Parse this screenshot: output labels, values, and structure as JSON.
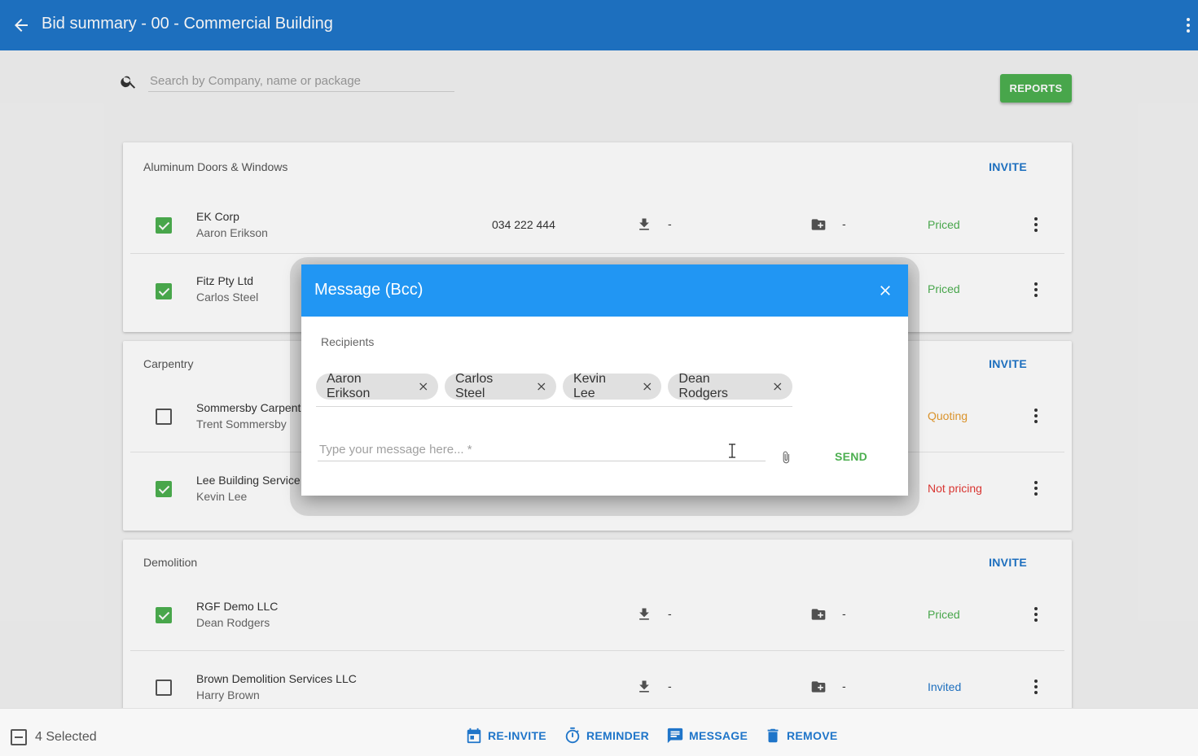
{
  "appbar": {
    "title": "Bid summary - 00 - Commercial Building"
  },
  "search": {
    "placeholder": "Search by Company, name or package"
  },
  "reports_label": "REPORTS",
  "groups": [
    {
      "title": "Aluminum Doors & Windows",
      "invite": "INVITE",
      "rows": [
        {
          "company": "EK Corp",
          "contact": "Aaron Erikson",
          "phone": "034 222 444",
          "download": "-",
          "folder": "-",
          "status": "Priced",
          "checked": true
        },
        {
          "company": "Fitz Pty Ltd",
          "contact": "Carlos Steel",
          "status": "Priced",
          "checked": true
        }
      ]
    },
    {
      "title": "Carpentry",
      "invite": "INVITE",
      "rows": [
        {
          "company": "Sommersby Carpent",
          "contact": "Trent Sommersby",
          "status": "Quoting",
          "checked": false
        },
        {
          "company": "Lee Building Service",
          "contact": "Kevin Lee",
          "status": "Not pricing",
          "checked": true
        }
      ]
    },
    {
      "title": "Demolition",
      "invite": "INVITE",
      "rows": [
        {
          "company": "RGF Demo LLC",
          "contact": "Dean Rodgers",
          "download": "-",
          "folder": "-",
          "status": "Priced",
          "checked": true
        },
        {
          "company": "Brown Demolition Services LLC",
          "contact": "Harry Brown",
          "download": "-",
          "folder": "-",
          "status": "Invited",
          "checked": false
        }
      ]
    }
  ],
  "modal": {
    "title": "Message (Bcc)",
    "recipients_label": "Recipients",
    "recipients": [
      "Aaron Erikson",
      "Carlos Steel",
      "Kevin Lee",
      "Dean Rodgers"
    ],
    "message_placeholder": "Type your message here... *",
    "send_label": "SEND"
  },
  "bottombar": {
    "selected": "4 Selected",
    "actions": [
      "RE-INVITE",
      "REMINDER",
      "MESSAGE",
      "REMOVE"
    ]
  },
  "colors": {
    "primary": "#1f75c9",
    "modal_header": "#2196f3",
    "priced": "#4caf50",
    "quoting": "#e69b2e",
    "not_pricing": "#e53935",
    "invited": "#1f75c9"
  }
}
